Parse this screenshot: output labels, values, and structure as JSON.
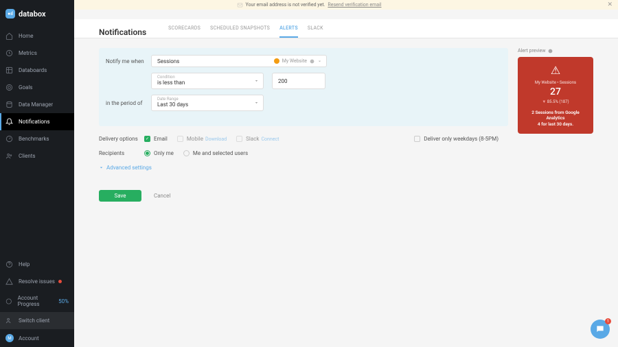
{
  "banner": {
    "text": "Your email address is not verified yet.",
    "link": "Resend verification email"
  },
  "brand": "databox",
  "sidebar": {
    "items": [
      {
        "label": "Home"
      },
      {
        "label": "Metrics"
      },
      {
        "label": "Databoards"
      },
      {
        "label": "Goals"
      },
      {
        "label": "Data Manager"
      },
      {
        "label": "Notifications"
      },
      {
        "label": "Benchmarks"
      },
      {
        "label": "Clients"
      }
    ],
    "bottom": [
      {
        "label": "Help"
      },
      {
        "label": "Resolve issues"
      },
      {
        "label": "Account Progress",
        "pct": "50%"
      },
      {
        "label": "Switch client"
      },
      {
        "label": "Account",
        "initial": "M"
      }
    ]
  },
  "header": {
    "title": "Notifications"
  },
  "tabs": [
    "SCORECARDS",
    "SCHEDULED SNAPSHOTS",
    "ALERTS",
    "SLACK"
  ],
  "form": {
    "notify_label": "Notify me when",
    "metric": "Sessions",
    "website": "My Website",
    "condition": {
      "label": "Condition",
      "value": "is less than"
    },
    "threshold": "200",
    "period_label": "in the period of",
    "range": {
      "label": "Date Range",
      "value": "Last 30 days"
    },
    "delivery_label": "Delivery options",
    "delivery": {
      "email": "Email",
      "mobile": "Mobile",
      "mobile_link": "Download",
      "slack": "Slack",
      "slack_link": "Connect",
      "weekday": "Deliver only weekdays (8-5PM)"
    },
    "recipients_label": "Recipients",
    "recipients": {
      "only_me": "Only me",
      "selected": "Me and selected users"
    },
    "advanced": "Advanced settings",
    "save": "Save",
    "cancel": "Cancel"
  },
  "preview": {
    "label": "Alert preview",
    "sub": "My Website • Sessions",
    "value": "27",
    "change": "85.5%",
    "count": "(187)",
    "text1": "2 Sessions from Google Analytics",
    "text2": "4 for last 30 days."
  },
  "chat_count": "1"
}
